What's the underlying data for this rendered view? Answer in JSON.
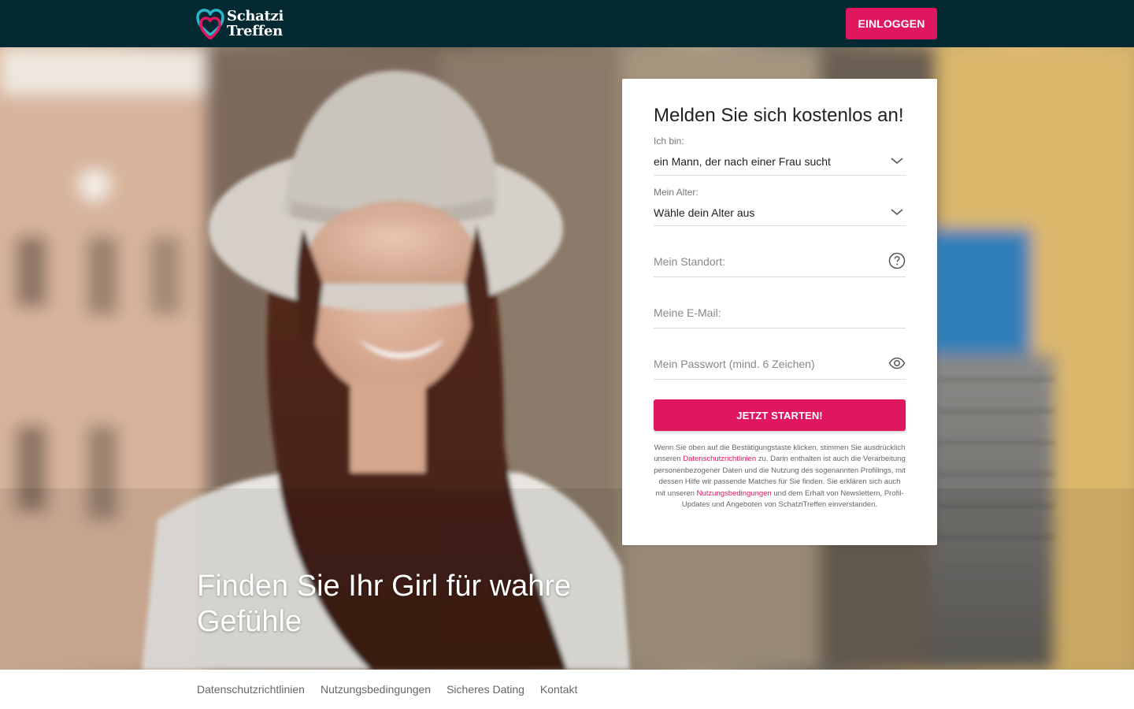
{
  "header": {
    "logo_line1": "Schatzi",
    "logo_line2": "Treffen",
    "login_label": "EINLOGGEN"
  },
  "hero": {
    "headline": "Finden Sie Ihr Girl für wahre Gefühle"
  },
  "form": {
    "title": "Melden Sie sich kostenlos an!",
    "gender_label": "Ich bin:",
    "gender_value": "ein Mann, der nach einer Frau sucht",
    "age_label": "Mein Alter:",
    "age_value": "Wähle dein Alter aus",
    "location_placeholder": "Mein Standort:",
    "email_placeholder": "Meine E-Mail:",
    "password_placeholder": "Mein Passwort (mind. 6 Zeichen)",
    "submit_label": "JETZT STARTEN!",
    "legal": {
      "part1": "Wenn Sie oben auf die Bestätigungstaste klicken, stimmen Sie ausdrücklich unseren ",
      "privacy_link": "Datenschutzrichtlinien",
      "part2": " zu. Darin enthalten ist auch die Verarbeitung personenbezogener Daten und die Nutzung des sogenannten Profilings, mit dessen Hilfe wir passende Matches für Sie finden. Sie erklären sich auch mit unseren ",
      "terms_link": "Nutzungsbedingungen",
      "part3": " und dem Erhalt von Newslettern, Profil-Updates und Angeboten von SchatziTreffen einverstanden."
    }
  },
  "footer": {
    "links": [
      "Datenschutzrichtlinien",
      "Nutzungsbedingungen",
      "Sicheres Dating",
      "Kontakt"
    ]
  },
  "icons": {
    "select_chevron": "chevron-down-icon",
    "location_help": "question-circle-icon",
    "password_toggle": "eye-icon",
    "logo": "heart-logo-icon"
  },
  "colors": {
    "header_bg": "#032a33",
    "accent": "#e0165f",
    "logo_teal": "#2ab8c9"
  }
}
